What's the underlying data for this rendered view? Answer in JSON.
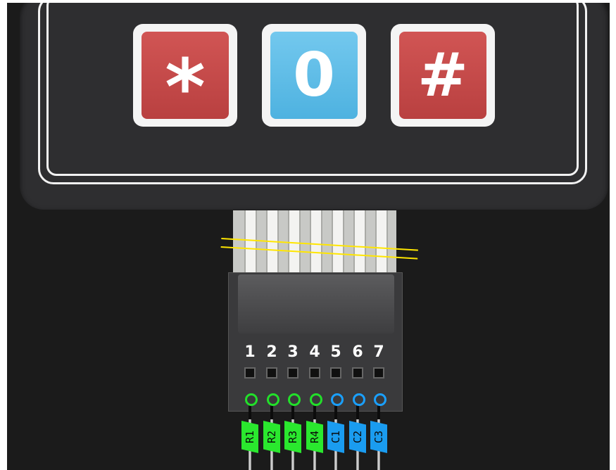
{
  "keypad": {
    "keys": [
      {
        "label": "*",
        "color": "#c84848"
      },
      {
        "label": "0",
        "color": "#5dbde8"
      },
      {
        "label": "#",
        "color": "#c84848"
      }
    ]
  },
  "connector": {
    "pin_numbers": [
      "1",
      "2",
      "3",
      "4",
      "5",
      "6",
      "7"
    ],
    "pin_labels": [
      "R1",
      "R2",
      "R3",
      "R4",
      "C1",
      "C2",
      "C3"
    ],
    "row_color": "#2ae82e",
    "column_color": "#1a9cf0",
    "cut_line_color": "#ffe600"
  }
}
